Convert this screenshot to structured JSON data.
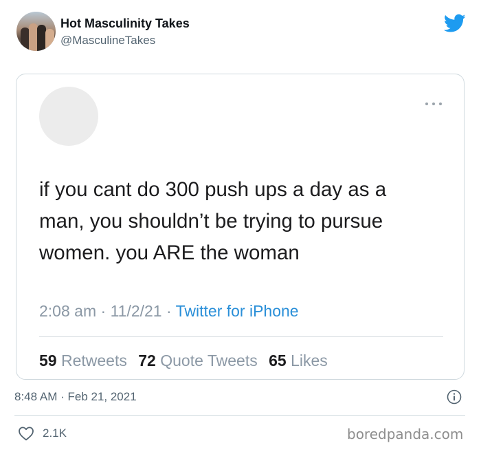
{
  "tweet": {
    "author": {
      "display_name": "Hot Masculinity Takes",
      "handle": "@MasculineTakes"
    },
    "timestamp": "8:48 AM · Feb 21, 2021",
    "likes": "2.1K",
    "brand_color": "#1d9bf0"
  },
  "quoted": {
    "text_lines": [
      "if you cant do 300 push ups a day as a",
      "man, you shouldn’t be trying to pursue",
      "women. you ARE the woman"
    ],
    "meta": {
      "time": "2:08 am",
      "date": "11/2/21",
      "source": "Twitter for iPhone"
    },
    "stats": {
      "retweets": "59",
      "retweets_label": "Retweets",
      "quote_tweets": "72",
      "quote_tweets_label": "Quote Tweets",
      "likes": "65",
      "likes_label": "Likes"
    }
  },
  "watermark": "boredpanda.com",
  "icons": [
    "twitter-bird-icon",
    "more-options-icon",
    "info-icon",
    "heart-icon"
  ]
}
